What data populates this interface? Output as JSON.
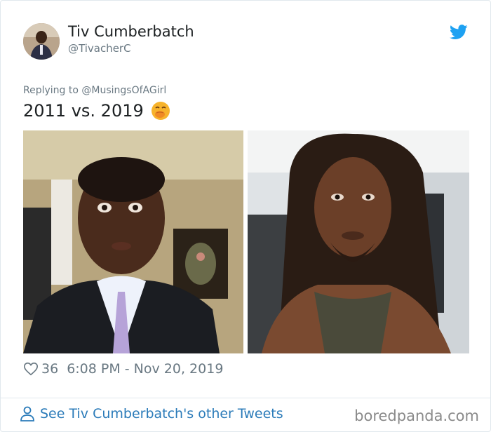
{
  "author": {
    "name": "Tiv Cumberbatch",
    "handle": "@TivacherC"
  },
  "reply_to": "Replying to @MusingsOfAGirl",
  "tweet": {
    "text": "2011 vs. 2019",
    "emoji": "face-with-hand-over-mouth"
  },
  "stats": {
    "likes": "36",
    "timestamp": "6:08 PM - Nov 20, 2019"
  },
  "footer": {
    "link": "See Tiv Cumberbatch's other Tweets"
  },
  "watermark": "boredpanda.com",
  "icons": {
    "bird": "twitter-bird-icon",
    "heart": "heart-icon",
    "person": "person-icon"
  },
  "colors": {
    "twitter_blue": "#1da1f2",
    "link_blue": "#2b7bb9",
    "muted_text": "#697882"
  }
}
